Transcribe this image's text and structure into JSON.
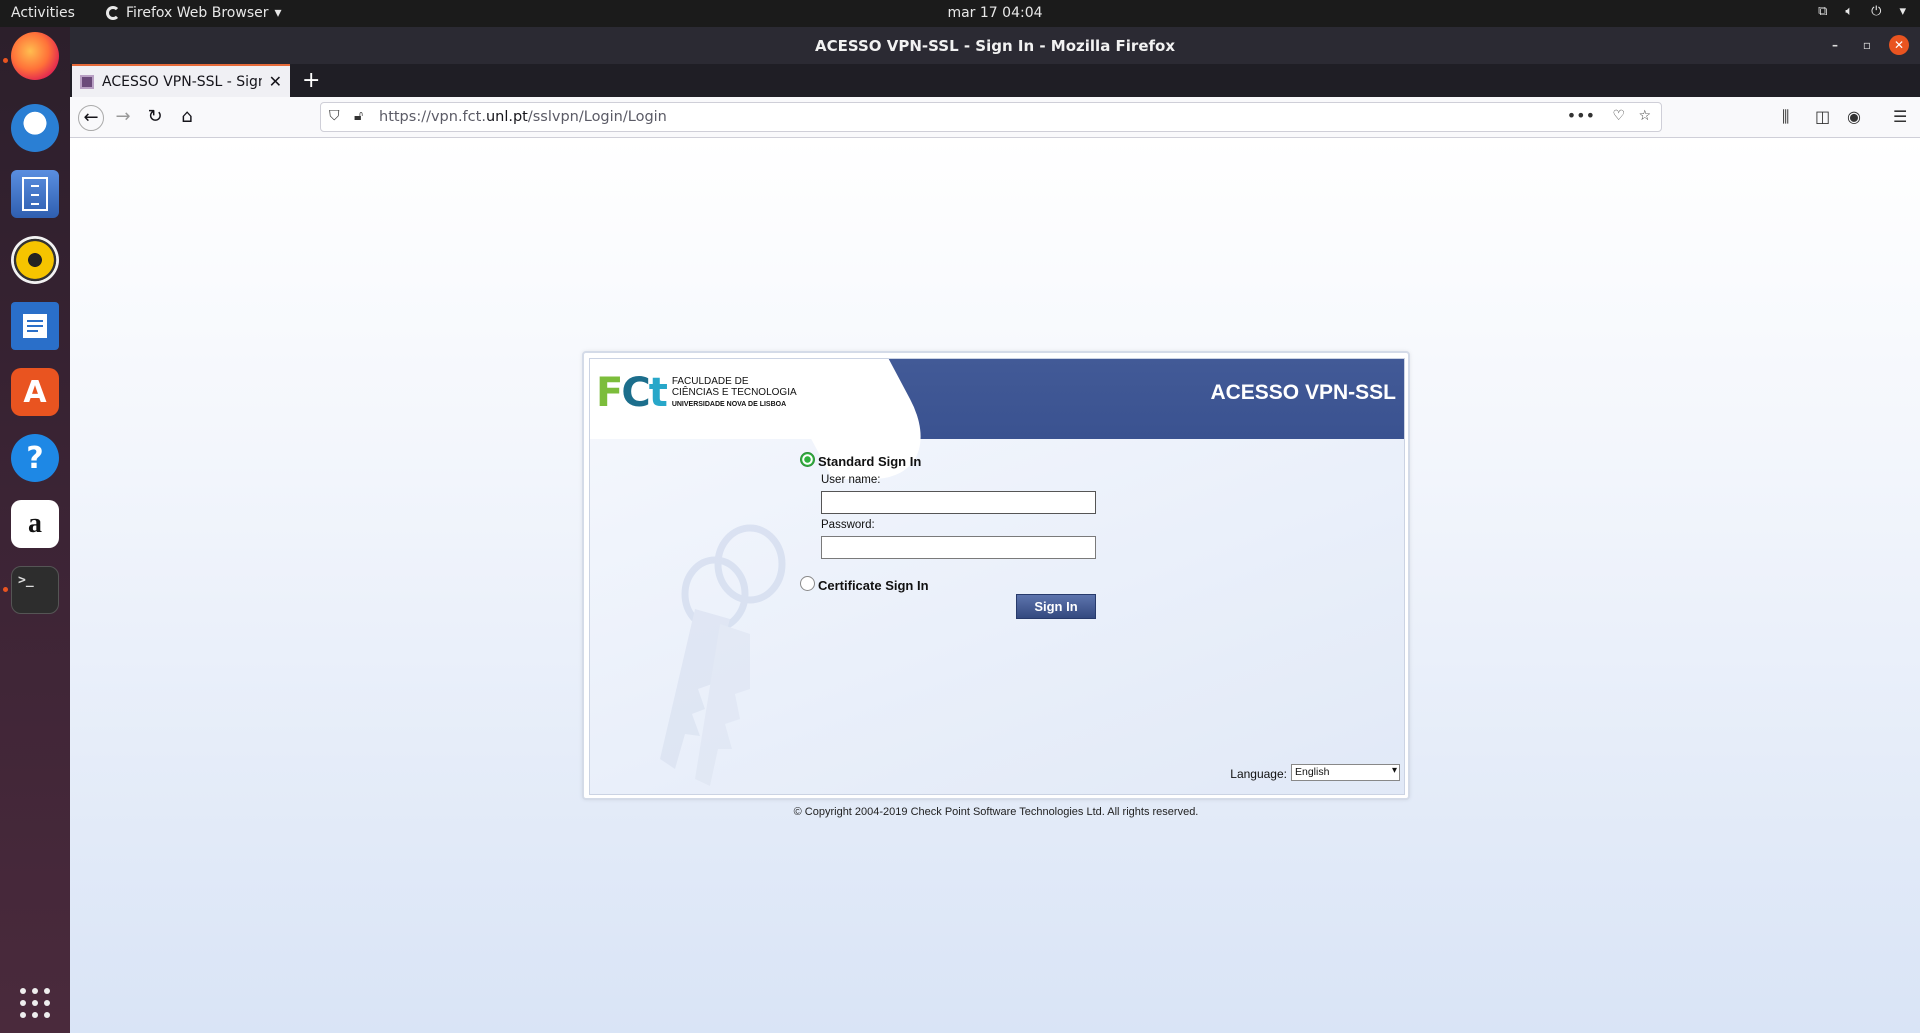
{
  "topbar": {
    "activities": "Activities",
    "app_menu": "Firefox Web Browser",
    "clock": "mar 17  04:04"
  },
  "dock": {
    "items": [
      "firefox-icon",
      "thunderbird-icon",
      "files-icon",
      "rhythmbox-icon",
      "writer-icon",
      "software-icon",
      "help-icon",
      "amazon-icon",
      "terminal-icon",
      "app-grid-icon"
    ],
    "amazon_label": "a",
    "help_label": "?",
    "terminal_label": ">_"
  },
  "window": {
    "title": "ACESSO VPN-SSL - Sign In - Mozilla Firefox"
  },
  "tab": {
    "title": "ACESSO VPN-SSL - Sign In"
  },
  "urlbar": {
    "prefix": "https://vpn.fct.",
    "domain": "unl.pt",
    "path": "/sslvpn/Login/Login"
  },
  "login": {
    "logo_line1": "FACULDADE DE",
    "logo_line2": "CIÊNCIAS E TECNOLOGIA",
    "logo_line3": "UNIVERSIDADE NOVA DE LISBOA",
    "title": "ACESSO VPN-SSL",
    "standard_label": "Standard Sign In",
    "username_label": "User name:",
    "username_value": "",
    "password_label": "Password:",
    "password_value": "",
    "certificate_label": "Certificate Sign In",
    "signin_label": "Sign In",
    "language_label": "Language:",
    "language_value": "English"
  },
  "footer": {
    "copyright": "© Copyright 2004-2019   Check Point Software Technologies Ltd. All rights reserved."
  },
  "colors": {
    "header_blue": "#3a5290",
    "signin_button": "#34497f",
    "ubuntu_orange": "#e95420"
  }
}
